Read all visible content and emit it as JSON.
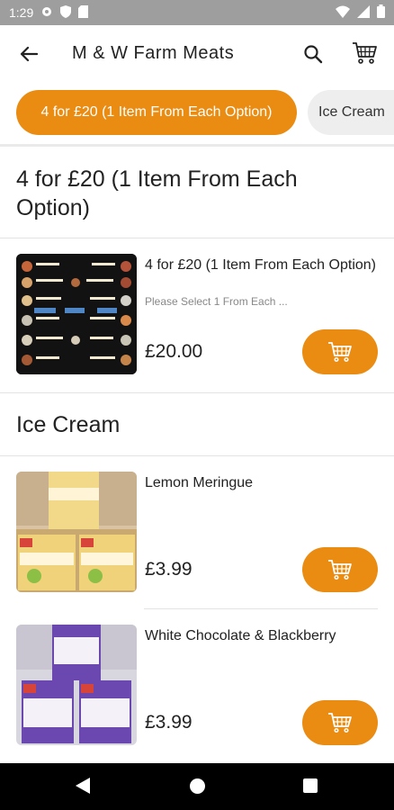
{
  "status_bar": {
    "time": "1:29"
  },
  "app_bar": {
    "title": "M & W Farm Meats"
  },
  "categories": [
    {
      "label": "4 for £20 (1 Item From Each Option)",
      "active": true
    },
    {
      "label": "Ice Cream",
      "active": false
    }
  ],
  "sections": [
    {
      "title": "4 for £20 (1 Item From Each Option)",
      "products": [
        {
          "name": "4 for £20 (1 Item From Each Option)",
          "description": "Please Select 1 From Each ...",
          "price": "£20.00"
        }
      ]
    },
    {
      "title": "Ice Cream",
      "products": [
        {
          "name": "Lemon Meringue",
          "description": "",
          "price": "£3.99"
        },
        {
          "name": "White Chocolate & Blackberry",
          "description": "",
          "price": "£3.99"
        }
      ]
    }
  ],
  "colors": {
    "accent": "#ea8b12",
    "status_bar": "#9e9e9e",
    "nav_bar": "#000000"
  },
  "icons": [
    "back-arrow-icon",
    "search-icon",
    "cart-icon",
    "add-to-cart-icon"
  ]
}
